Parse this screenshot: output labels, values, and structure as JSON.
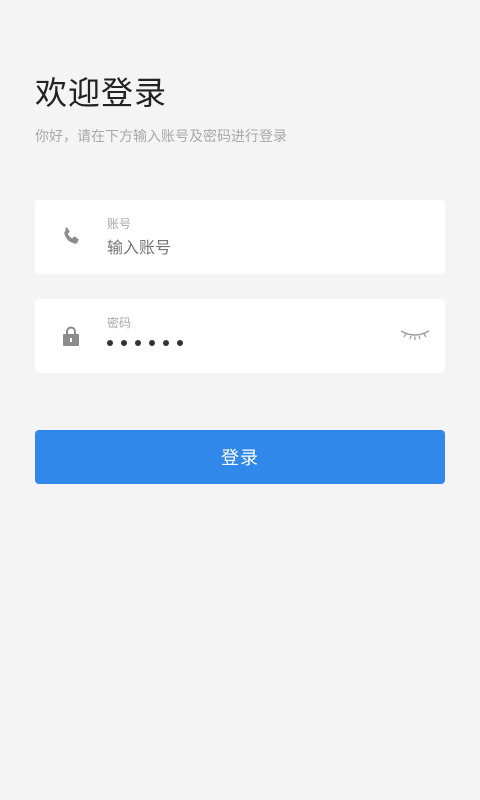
{
  "header": {
    "title": "欢迎登录",
    "subtitle": "你好，请在下方输入账号及密码进行登录"
  },
  "account": {
    "label": "账号",
    "placeholder": "输入账号",
    "value": "",
    "icon": "phone-icon"
  },
  "password": {
    "label": "密码",
    "masked_value": "••••••",
    "icon": "lock-icon",
    "toggle_icon": "eye-closed-icon"
  },
  "login_button": {
    "label": "登录"
  },
  "colors": {
    "accent": "#2f88ea",
    "background": "#f4f4f4",
    "card": "#ffffff"
  }
}
